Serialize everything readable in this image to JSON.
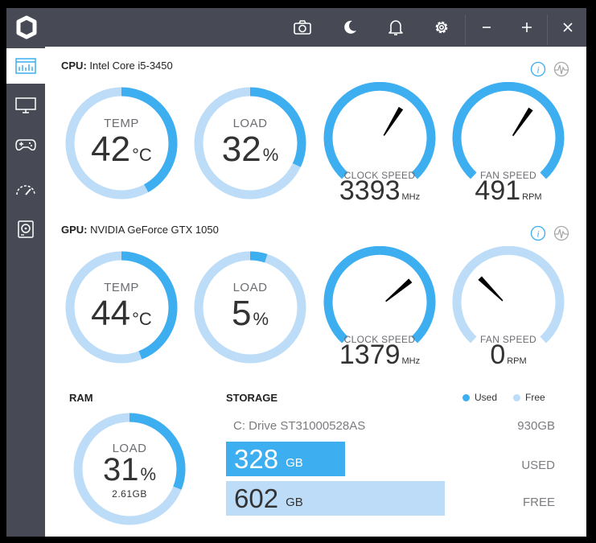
{
  "colors": {
    "accent": "#3daef0",
    "track": "#bcdcf8",
    "titlebar": "#474955"
  },
  "titlebar_icons": [
    "camera-icon",
    "moon-icon",
    "bell-icon",
    "gear-icon",
    "minimize-icon",
    "maximize-icon",
    "close-icon"
  ],
  "sidebar_icons": [
    "dashboard-icon",
    "monitor-icon",
    "gamepad-icon",
    "speedometer-icon",
    "hard-drive-icon"
  ],
  "cpu": {
    "prefix": "CPU:",
    "name": "Intel Core i5-3450",
    "temp": {
      "label": "TEMP",
      "value": "42",
      "unit": "°C",
      "percent": 0.42
    },
    "load": {
      "label": "LOAD",
      "value": "32",
      "unit": "%",
      "percent": 0.32
    },
    "clock": {
      "label": "CLOCK SPEED",
      "value": "3393",
      "unit": "MHz",
      "needle_angle": 122
    },
    "fan": {
      "label": "FAN SPEED",
      "value": "491",
      "unit": "RPM",
      "needle_angle": 124
    }
  },
  "gpu": {
    "prefix": "GPU:",
    "name": "NVIDIA GeForce GTX 1050",
    "temp": {
      "label": "TEMP",
      "value": "44",
      "unit": "°C",
      "percent": 0.44
    },
    "load": {
      "label": "LOAD",
      "value": "5",
      "unit": "%",
      "percent": 0.05
    },
    "clock": {
      "label": "CLOCK SPEED",
      "value": "1379",
      "unit": "MHz",
      "needle_angle": 140
    },
    "fan": {
      "label": "FAN SPEED",
      "value": "0",
      "unit": "RPM",
      "needle_angle": 45
    }
  },
  "ram": {
    "title": "RAM",
    "label": "LOAD",
    "value": "31",
    "unit": "%",
    "sub": "2.61GB",
    "percent": 0.31
  },
  "storage": {
    "title": "STORAGE",
    "legend_used": "Used",
    "legend_free": "Free",
    "drive_name": "C: Drive ST31000528AS",
    "drive_total": "930GB",
    "used_value": "328",
    "used_unit": "GB",
    "used_label": "USED",
    "used_fraction": 0.353,
    "free_value": "602",
    "free_unit": "GB",
    "free_label": "FREE",
    "free_fraction": 0.647
  }
}
